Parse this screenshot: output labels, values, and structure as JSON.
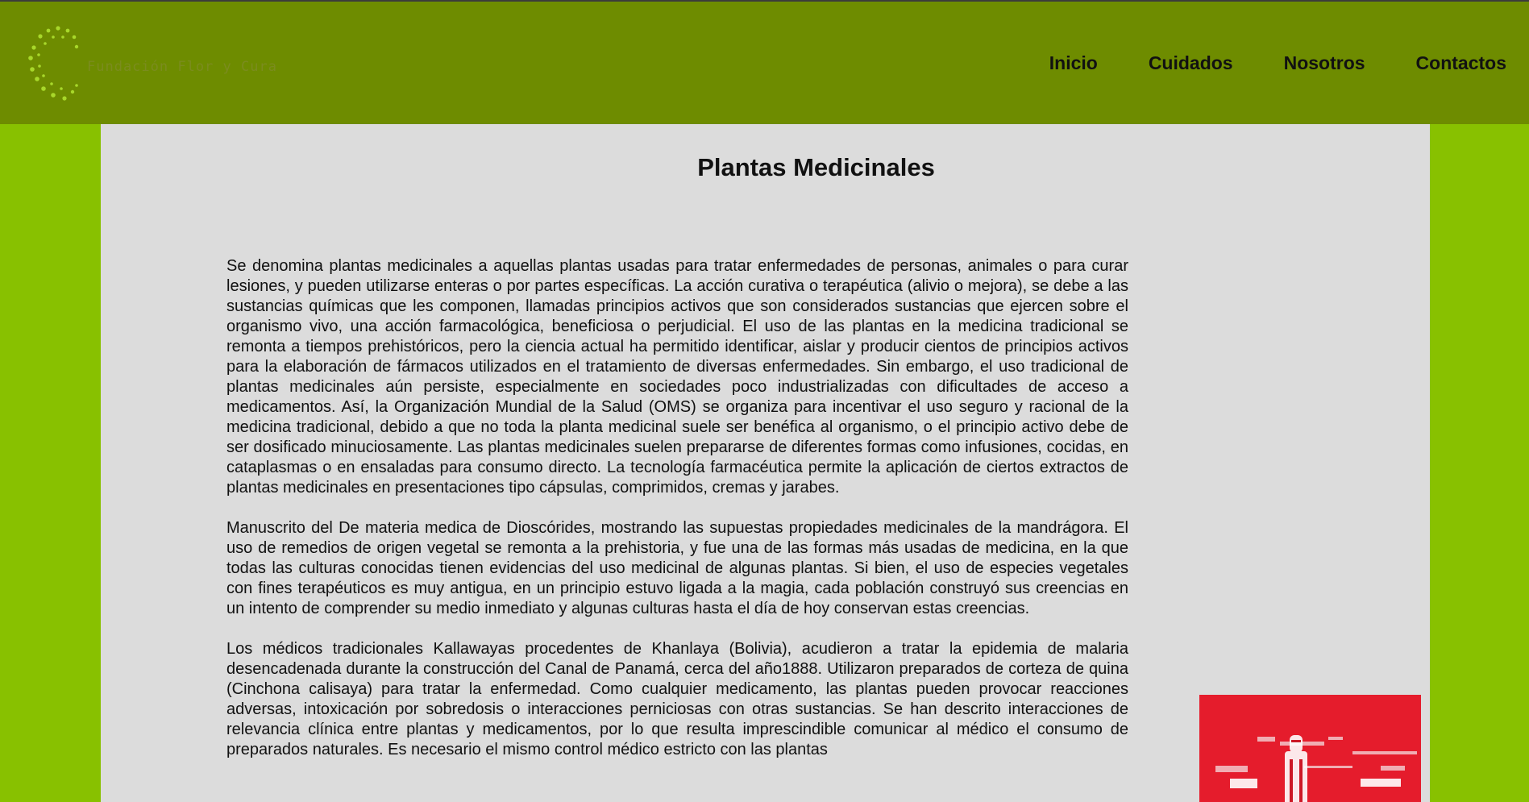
{
  "header": {
    "brand": "Fundación Flor y Cura",
    "nav": [
      "Inicio",
      "Cuidados",
      "Nosotros",
      "Contactos"
    ]
  },
  "main": {
    "title": "Plantas Medicinales",
    "paragraphs": [
      "Se denomina plantas medicinales a aquellas plantas usadas para tratar enfermedades de personas, animales o para curar lesiones, y pueden utilizarse enteras o por partes específicas. La acción curativa o terapéutica (alivio o mejora), se debe a las sustancias químicas que les componen, llamadas principios activos que son considerados sustancias que ejercen sobre el organismo vivo, una acción farmacológica, beneficiosa o perjudicial. El uso de las plantas en la medicina tradicional se remonta a tiempos prehistóricos, pero la ciencia actual ha permitido identificar, aislar y producir cientos de principios activos para la elaboración de fármacos utilizados en el tratamiento de diversas enfermedades. Sin embargo, el uso tradicional de plantas medicinales aún persiste, especialmente en sociedades poco industrializadas con dificultades de acceso a medicamentos. Así, la Organización Mundial de la Salud (OMS) se organiza para incentivar el uso seguro y racional de la medicina tradicional, debido a que no toda la planta medicinal suele ser benéfica al organismo, o el principio activo debe de ser dosificado minuciosamente. Las plantas medicinales suelen prepararse de diferentes formas como infusiones, cocidas, en cataplasmas o en ensaladas para consumo directo. La tecnología farmacéutica permite la aplicación de ciertos extractos de plantas medicinales en presentaciones tipo cápsulas, comprimidos, cremas y jarabes.",
      "Manuscrito del De materia medica de Dioscórides, mostrando las supuestas propiedades medicinales de la mandrágora. El uso de remedios de origen vegetal se remonta a la prehistoria, y fue una de las formas más usadas de medicina, en la que todas las culturas conocidas tienen evidencias del uso medicinal de algunas plantas. Si bien, el uso de especies vegetales con fines terapéuticos es muy antigua, en un principio estuvo ligada a la magia, cada población construyó sus creencias en un intento de comprender su medio inmediato y algunas culturas hasta el día de hoy conservan estas creencias.",
      "Los médicos tradicionales Kallawayas procedentes de Khanlaya (Bolivia), acudieron a tratar la epidemia de malaria desencadenada durante la construcción del Canal de Panamá, cerca del año1888. Utilizaron preparados de corteza de quina (Cinchona calisaya) para tratar la enfermedad. Como cualquier medicamento, las plantas pueden provocar reacciones adversas, intoxicación por sobredosis o interacciones perniciosas con otras sustancias. Se han descrito interacciones de relevancia clínica entre plantas y medicamentos, por lo que resulta imprescindible comunicar al médico el consumo de preparados naturales. Es necesario el mismo control médico estricto con las plantas"
    ]
  },
  "colors": {
    "page_bg": "#88c100",
    "header_bg": "#6e8c00",
    "content_bg": "#dcdcdc",
    "logo_dots": "#a8d82a",
    "image_bg": "#e51c2c"
  }
}
